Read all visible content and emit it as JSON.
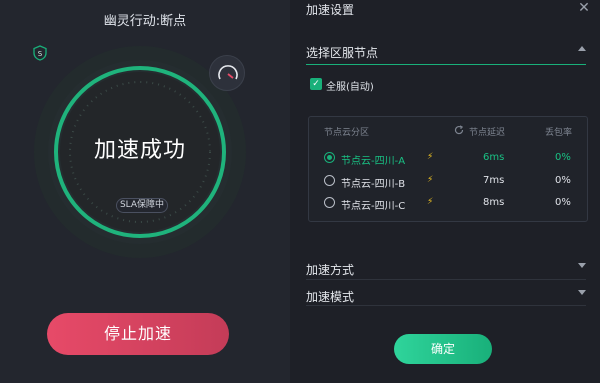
{
  "left": {
    "title": "幽灵行动:断点",
    "status": "加速成功",
    "sla": "SLA保障中",
    "stop_label": "停止加速"
  },
  "right": {
    "title": "加速设置",
    "section_region": "选择区服节点",
    "auto_label": "全服(自动)",
    "table": {
      "headers": [
        "节点云分区",
        "节点延迟",
        "丢包率"
      ],
      "rows": [
        {
          "name": "节点云-四川-A",
          "latency": "6ms",
          "loss": "0%",
          "selected": true
        },
        {
          "name": "节点云-四川-B",
          "latency": "7ms",
          "loss": "0%",
          "selected": false
        },
        {
          "name": "节点云-四川-C",
          "latency": "8ms",
          "loss": "0%",
          "selected": false
        }
      ]
    },
    "section_method": "加速方式",
    "section_mode": "加速模式",
    "confirm_label": "确定"
  },
  "colors": {
    "accent": "#19b07a",
    "danger": "#e74a68",
    "bolt": "#f3c623"
  }
}
